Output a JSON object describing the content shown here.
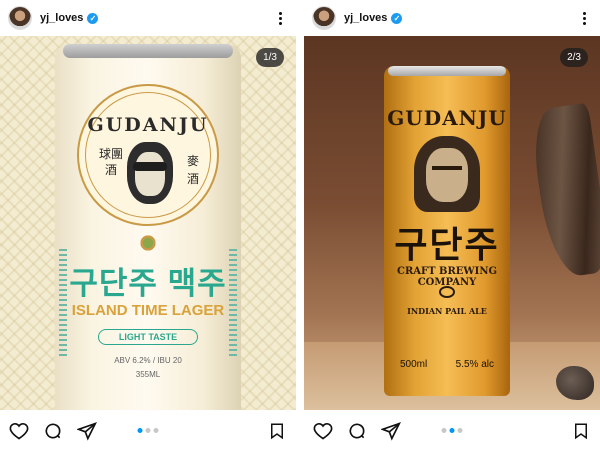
{
  "posts": [
    {
      "username": "yj_loves",
      "counter": "1/3",
      "can": {
        "brand": "GUDANJU",
        "hanja_left": "球團酒",
        "hanja_right": "麥酒",
        "korean": "구단주 맥주",
        "tagline": "ISLAND TIME LAGER",
        "pill": "LIGHT TASTE",
        "abv": "ABV 6.2% / IBU 20",
        "volume": "355ML"
      },
      "carousel_active_index": 0,
      "carousel_count": 3
    },
    {
      "username": "yj_loves",
      "counter": "2/3",
      "can": {
        "brand": "GUDANJU",
        "korean": "구단주",
        "subtitle": "CRAFT BREWING COMPANY",
        "style": "INDIAN PAIL ALE",
        "volume": "500ml",
        "alc": "5.5% alc"
      },
      "carousel_active_index": 1,
      "carousel_count": 3
    }
  ],
  "colors": {
    "verified": "#1d9bf0",
    "dot_active": "#0095f6",
    "dot_inactive": "#c8c8c8",
    "teal": "#2aa88f",
    "gold": "#d9a23a"
  },
  "icons": [
    "heart-icon",
    "comment-icon",
    "share-icon",
    "bookmark-icon",
    "more-icon",
    "verified-icon"
  ]
}
